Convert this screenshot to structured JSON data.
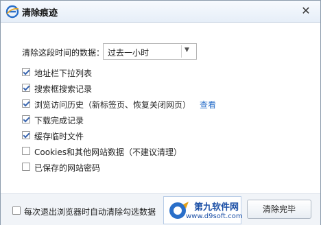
{
  "window": {
    "title": "清除痕迹",
    "close_glyph": "✕"
  },
  "period": {
    "label": "清除这段时间的数据：",
    "selected": "过去一小时"
  },
  "options": [
    {
      "label": "地址栏下拉列表",
      "checked": true
    },
    {
      "label": "搜索框搜索记录",
      "checked": true
    },
    {
      "label": "浏览访问历史（新标签页、恢复关闭网页）",
      "checked": true
    },
    {
      "label": "下载完成记录",
      "checked": true
    },
    {
      "label": "缓存临时文件",
      "checked": true
    },
    {
      "label": "Cookies和其他网站数据（不建议清理）",
      "checked": false
    },
    {
      "label": "已保存的网站密码",
      "checked": false
    }
  ],
  "view_link": "查看",
  "footer": {
    "auto_clear_label": "每次退出浏览器时自动清除勾选数据",
    "auto_clear_checked": false,
    "clear_button": "清除完毕"
  },
  "watermark": {
    "title": "第九软件网",
    "url": "www.d9soft.com"
  },
  "colors": {
    "accent": "#2a6fc9",
    "title_bar": "#e6eef8",
    "footer": "#f1f4f8"
  }
}
